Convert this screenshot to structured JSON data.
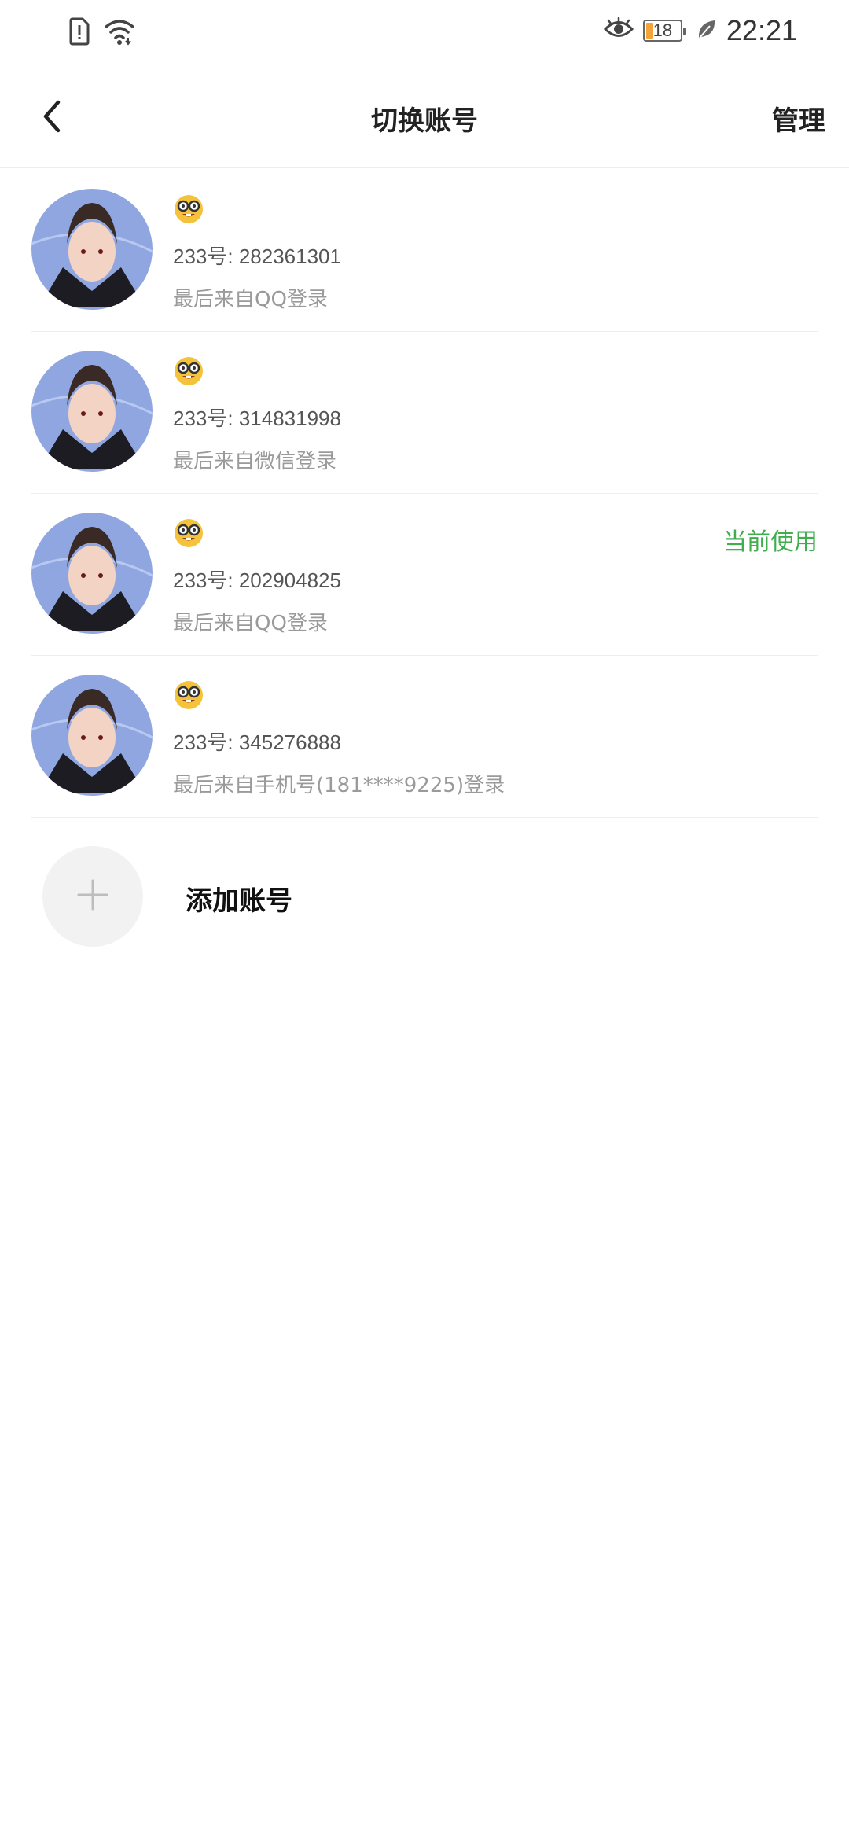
{
  "status_bar": {
    "time": "22:21",
    "battery": "18",
    "icons_left": [
      "sim-alert-icon",
      "wifi-icon"
    ],
    "icons_right": [
      "eye-icon",
      "battery-icon",
      "leaf-icon"
    ],
    "battery_color": "#f2a43a"
  },
  "header": {
    "title": "切换账号",
    "manage_label": "管理",
    "back_icon": "chevron-left-icon"
  },
  "accounts": [
    {
      "nickname_emoji": "nerd-face-emoji",
      "id_text": "233号: 282361301",
      "source_text": "最后来自QQ登录",
      "current_label": ""
    },
    {
      "nickname_emoji": "nerd-face-emoji",
      "id_text": "233号: 314831998",
      "source_text": "最后来自微信登录",
      "current_label": ""
    },
    {
      "nickname_emoji": "nerd-face-emoji",
      "id_text": "233号: 202904825",
      "source_text": "最后来自QQ登录",
      "current_label": "当前使用"
    },
    {
      "nickname_emoji": "nerd-face-emoji",
      "id_text": "233号: 345276888",
      "source_text": "最后来自手机号(181****9225)登录",
      "current_label": ""
    }
  ],
  "add_account": {
    "label": "添加账号",
    "icon": "plus-icon"
  },
  "colors": {
    "accent_green": "#3fae4f",
    "secondary_text": "#9a9a9a",
    "divider": "#eeeeee"
  }
}
